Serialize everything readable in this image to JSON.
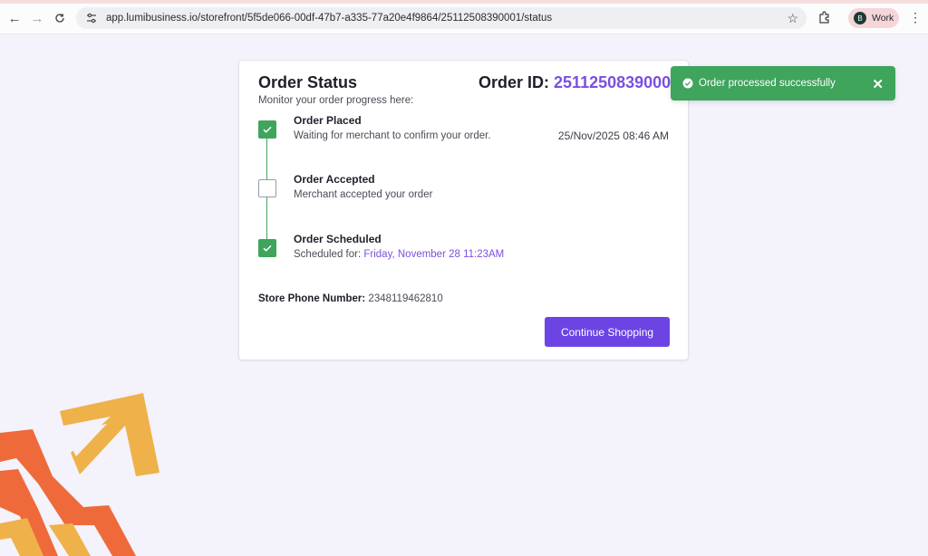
{
  "browser": {
    "url": "app.lumibusiness.io/storefront/5f5de066-00df-47b7-a335-77a20e4f9864/25112508390001/status",
    "profile_initial": "B",
    "profile_name": "Work"
  },
  "order": {
    "title": "Order Status",
    "subtitle": "Monitor your order progress here:",
    "id_label": "Order ID:",
    "id_value": "25112508390001",
    "placed_at": "25/Nov/2025 08:46 AM",
    "steps": [
      {
        "label": "Order Placed",
        "description": "Waiting for merchant to confirm your order.",
        "completed": true
      },
      {
        "label": "Order Accepted",
        "description": "Merchant accepted your order",
        "completed": false
      },
      {
        "label": "Order Scheduled",
        "description_prefix": "Scheduled for:",
        "description_highlight": "Friday, November 28 11:23AM",
        "completed": true
      }
    ],
    "phone_label": "Store Phone Number:",
    "phone_value": "2348119462810",
    "continue_label": "Continue Shopping"
  },
  "toast": {
    "message": "Order processed successfully",
    "color": "#3fa45c"
  },
  "colors": {
    "accent": "#6c44e4",
    "link": "#7b4fe0",
    "success": "#3fa45c"
  }
}
